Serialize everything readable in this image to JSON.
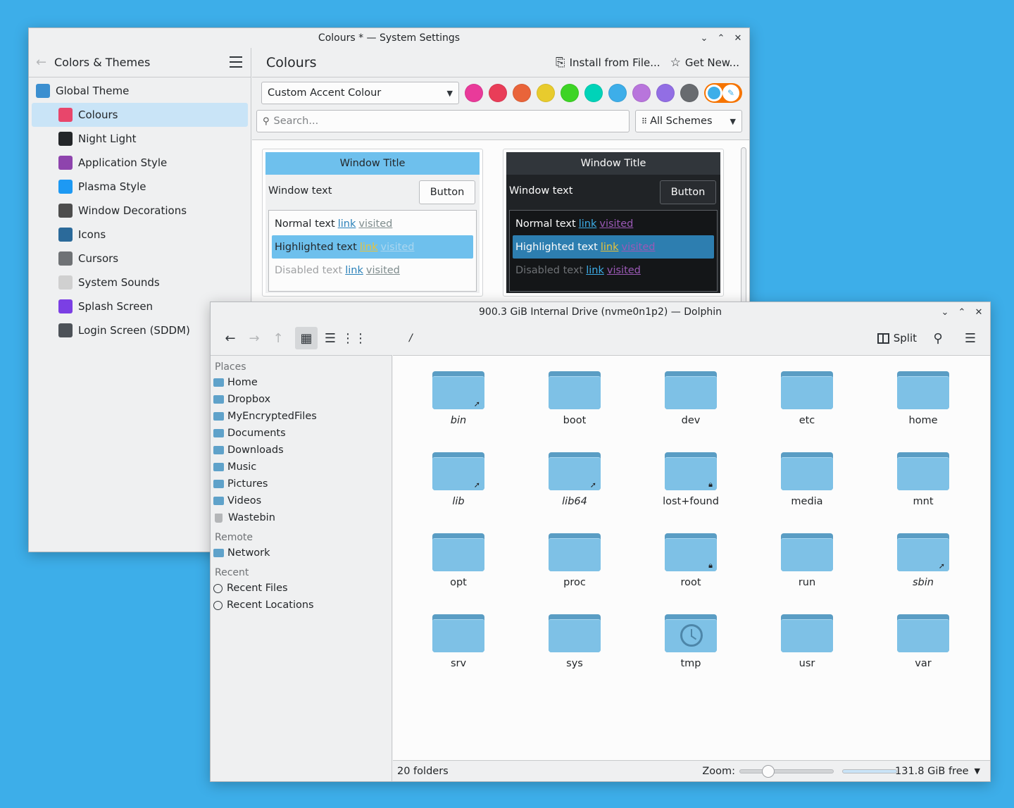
{
  "settings": {
    "window_title": "Colours * — System Settings",
    "sidebar": {
      "back_label": "Colors & Themes",
      "items": [
        {
          "label": "Global Theme",
          "icon": "global-theme-icon",
          "color": "#3b8fd0"
        },
        {
          "label": "Colours",
          "icon": "colours-icon",
          "color": "#e8466b"
        },
        {
          "label": "Night Light",
          "icon": "lightbulb-icon",
          "color": "#232629"
        },
        {
          "label": "Application Style",
          "icon": "application-style-icon",
          "color": "#8e44ad"
        },
        {
          "label": "Plasma Style",
          "icon": "plasma-style-icon",
          "color": "#1d99f3"
        },
        {
          "label": "Window Decorations",
          "icon": "window-decorations-icon",
          "color": "#4d4d4d"
        },
        {
          "label": "Icons",
          "icon": "icons-icon",
          "color": "#2b6a9a"
        },
        {
          "label": "Cursors",
          "icon": "cursor-icon",
          "color": "#6f7275"
        },
        {
          "label": "System Sounds",
          "icon": "music-note-icon",
          "color": "#d0d0d0"
        },
        {
          "label": "Splash Screen",
          "icon": "splash-screen-icon",
          "color": "#7b3fe4"
        },
        {
          "label": "Login Screen (SDDM)",
          "icon": "login-screen-icon",
          "color": "#4d5258"
        }
      ],
      "active_index": 1
    },
    "page_title": "Colours",
    "install_label": "Install from File...",
    "get_new_label": "Get New...",
    "accent_combo": "Custom Accent Colour",
    "accent_swatches": [
      "#e93a9a",
      "#e93d58",
      "#e9643a",
      "#e8cb2d",
      "#3dd425",
      "#00d3b8",
      "#3daee9",
      "#b875dc",
      "#926ee4",
      "#686b6f"
    ],
    "search_placeholder": "Search...",
    "filter_combo": "All Schemes",
    "light_preview": {
      "window_title": "Window Title",
      "window_text": "Window text",
      "button": "Button",
      "normal_text": "Normal text",
      "highlighted_text": "Highlighted text",
      "disabled_text": "Disabled text",
      "link": "link",
      "visited": "visited"
    },
    "dark_preview": {
      "window_title": "Window Title",
      "window_text": "Window text",
      "button": "Button",
      "normal_text": "Normal text",
      "highlighted_text": "Highlighted text",
      "disabled_text": "Disabled text",
      "link": "link",
      "visited": "visited"
    }
  },
  "dolphin": {
    "window_title": "900.3 GiB Internal Drive (nvme0n1p2) — Dolphin",
    "breadcrumb": "/",
    "split_label": "Split",
    "places": {
      "places_heading": "Places",
      "places_items": [
        "Home",
        "Dropbox",
        "MyEncryptedFiles",
        "Documents",
        "Downloads",
        "Music",
        "Pictures",
        "Videos",
        "Wastebin"
      ],
      "remote_heading": "Remote",
      "remote_items": [
        "Network"
      ],
      "recent_heading": "Recent",
      "recent_items": [
        "Recent Files",
        "Recent Locations"
      ]
    },
    "folders": [
      {
        "name": "bin",
        "italic": true,
        "emblem": "symlink"
      },
      {
        "name": "boot",
        "italic": false,
        "emblem": ""
      },
      {
        "name": "dev",
        "italic": false,
        "emblem": ""
      },
      {
        "name": "etc",
        "italic": false,
        "emblem": ""
      },
      {
        "name": "home",
        "italic": false,
        "emblem": ""
      },
      {
        "name": "lib",
        "italic": true,
        "emblem": "symlink"
      },
      {
        "name": "lib64",
        "italic": true,
        "emblem": "symlink"
      },
      {
        "name": "lost+found",
        "italic": false,
        "emblem": "lock"
      },
      {
        "name": "media",
        "italic": false,
        "emblem": ""
      },
      {
        "name": "mnt",
        "italic": false,
        "emblem": ""
      },
      {
        "name": "opt",
        "italic": false,
        "emblem": ""
      },
      {
        "name": "proc",
        "italic": false,
        "emblem": ""
      },
      {
        "name": "root",
        "italic": false,
        "emblem": "lock"
      },
      {
        "name": "run",
        "italic": false,
        "emblem": ""
      },
      {
        "name": "sbin",
        "italic": true,
        "emblem": "symlink"
      },
      {
        "name": "srv",
        "italic": false,
        "emblem": ""
      },
      {
        "name": "sys",
        "italic": false,
        "emblem": ""
      },
      {
        "name": "tmp",
        "italic": false,
        "emblem": "clock"
      },
      {
        "name": "usr",
        "italic": false,
        "emblem": ""
      },
      {
        "name": "var",
        "italic": false,
        "emblem": ""
      }
    ],
    "status_count": "20 folders",
    "zoom_label": "Zoom:",
    "zoom_level": 0.3,
    "free_space": "131.8 GiB free",
    "free_ratio": 0.15
  }
}
